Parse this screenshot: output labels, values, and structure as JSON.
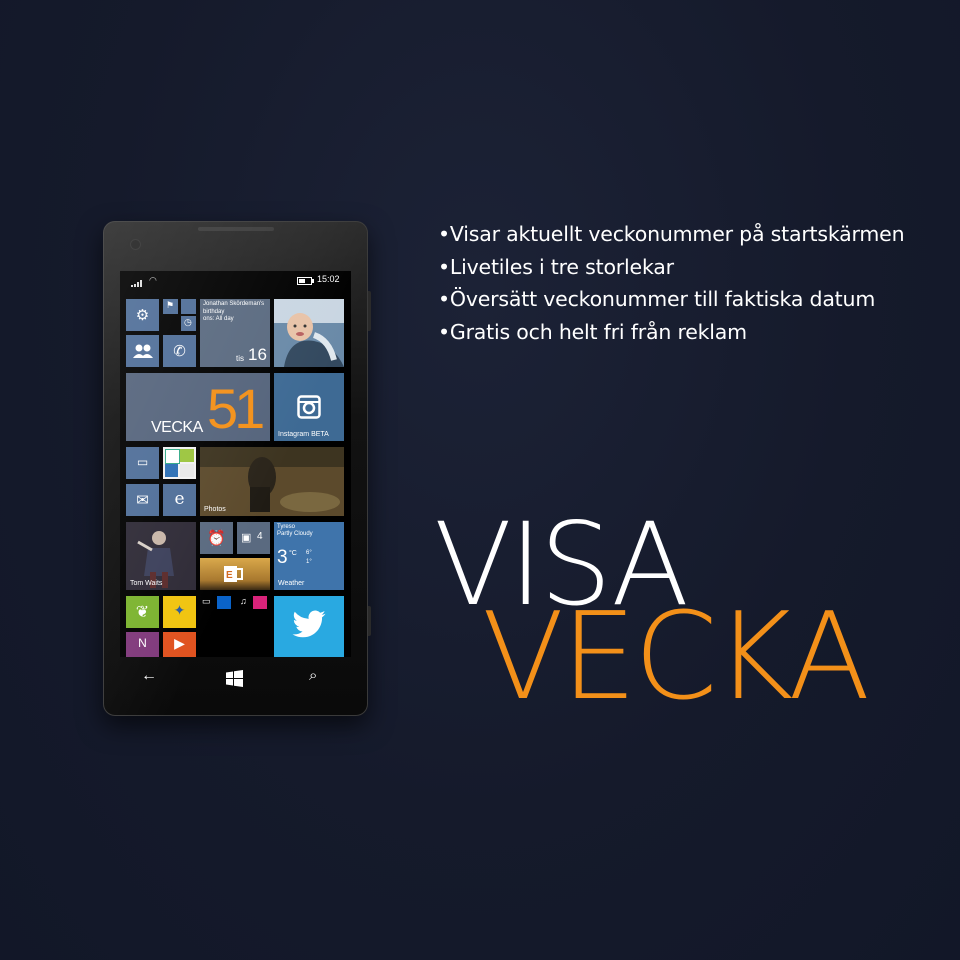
{
  "features": [
    "•Visar aktuellt veckonummer på startskärmen",
    "•Livetiles i tre storlekar",
    "•Översätt veckonummer till faktiska datum",
    "•Gratis och helt fri från reklam"
  ],
  "title": {
    "line1": "VISA",
    "line2": "VECKA"
  },
  "colors": {
    "accent": "#f39019",
    "background": "#161b2c",
    "tile_blue": "#4f6e98"
  },
  "phone": {
    "status": {
      "time": "15:02"
    },
    "tiles": {
      "calendar": {
        "event": "Jonathan Skördeman's birthday",
        "event_when": "ons: All day",
        "day": "tis",
        "date": "16"
      },
      "vecka": {
        "label": "VECKA",
        "number": "51"
      },
      "instagram": {
        "label": "Instagram BETA"
      },
      "photos": {
        "label": "Photos"
      },
      "music": {
        "label": "Tom Waits"
      },
      "store": {
        "count": "4"
      },
      "weather": {
        "location": "Tyreso",
        "condition": "Partly Cloudy",
        "temp": "3",
        "unit": "°C",
        "high": "6°",
        "low": "1°",
        "label": "Weather"
      }
    },
    "icons": [
      "settings-icon",
      "transit-icon",
      "people-icon",
      "phone-icon",
      "instagram-icon",
      "messaging-icon",
      "mail-icon",
      "ie-icon",
      "alarm-icon",
      "store-icon",
      "twitter-icon",
      "back-icon",
      "windows-icon",
      "search-icon"
    ]
  }
}
